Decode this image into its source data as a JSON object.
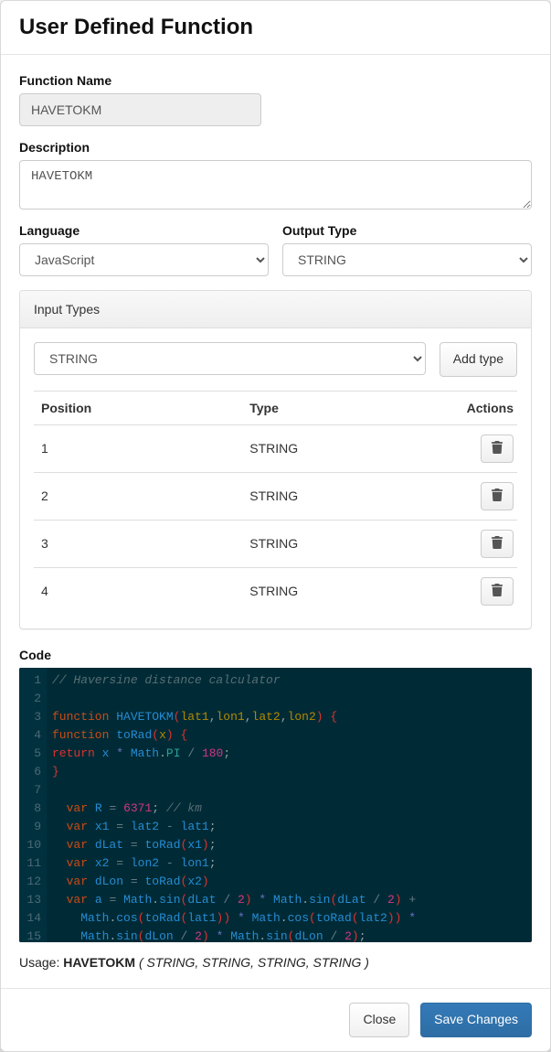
{
  "header": {
    "title": "User Defined Function"
  },
  "form": {
    "functionName": {
      "label": "Function Name",
      "value": "HAVETOKM"
    },
    "description": {
      "label": "Description",
      "value": "HAVETOKM"
    },
    "language": {
      "label": "Language",
      "value": "JavaScript"
    },
    "outputType": {
      "label": "Output Type",
      "value": "STRING"
    }
  },
  "inputTypes": {
    "heading": "Input Types",
    "newTypeSelected": "STRING",
    "addButton": "Add type",
    "columns": {
      "position": "Position",
      "type": "Type",
      "actions": "Actions"
    },
    "rows": [
      {
        "position": "1",
        "type": "STRING"
      },
      {
        "position": "2",
        "type": "STRING"
      },
      {
        "position": "3",
        "type": "STRING"
      },
      {
        "position": "4",
        "type": "STRING"
      }
    ]
  },
  "code": {
    "label": "Code",
    "lines": [
      {
        "n": "1",
        "tokens": [
          {
            "c": "tok-comment",
            "t": "// Haversine distance calculator"
          }
        ]
      },
      {
        "n": "2",
        "tokens": []
      },
      {
        "n": "3",
        "tokens": [
          {
            "c": "tok-keyword",
            "t": "function"
          },
          {
            "c": "tok-plain",
            "t": " "
          },
          {
            "c": "tok-funcname",
            "t": "HAVETOKM"
          },
          {
            "c": "tok-brace",
            "t": "("
          },
          {
            "c": "tok-param",
            "t": "lat1"
          },
          {
            "c": "tok-plain",
            "t": ","
          },
          {
            "c": "tok-param",
            "t": "lon1"
          },
          {
            "c": "tok-plain",
            "t": ","
          },
          {
            "c": "tok-param",
            "t": "lat2"
          },
          {
            "c": "tok-plain",
            "t": ","
          },
          {
            "c": "tok-param",
            "t": "lon2"
          },
          {
            "c": "tok-brace",
            "t": ")"
          },
          {
            "c": "tok-plain",
            "t": " "
          },
          {
            "c": "tok-brace",
            "t": "{"
          }
        ]
      },
      {
        "n": "4",
        "tokens": [
          {
            "c": "tok-keyword",
            "t": "function"
          },
          {
            "c": "tok-plain",
            "t": " "
          },
          {
            "c": "tok-funcname",
            "t": "toRad"
          },
          {
            "c": "tok-brace",
            "t": "("
          },
          {
            "c": "tok-param",
            "t": "x"
          },
          {
            "c": "tok-brace",
            "t": ")"
          },
          {
            "c": "tok-plain",
            "t": " "
          },
          {
            "c": "tok-brace",
            "t": "{"
          }
        ]
      },
      {
        "n": "5",
        "tokens": [
          {
            "c": "tok-ret",
            "t": "return"
          },
          {
            "c": "tok-plain",
            "t": " "
          },
          {
            "c": "tok-ident",
            "t": "x"
          },
          {
            "c": "tok-plain",
            "t": " "
          },
          {
            "c": "tok-star",
            "t": "*"
          },
          {
            "c": "tok-plain",
            "t": " "
          },
          {
            "c": "tok-ident",
            "t": "Math"
          },
          {
            "c": "tok-plain",
            "t": "."
          },
          {
            "c": "tok-member",
            "t": "PI"
          },
          {
            "c": "tok-plain",
            "t": " "
          },
          {
            "c": "tok-op",
            "t": "/"
          },
          {
            "c": "tok-plain",
            "t": " "
          },
          {
            "c": "tok-num",
            "t": "180"
          },
          {
            "c": "tok-plain",
            "t": ";"
          }
        ]
      },
      {
        "n": "6",
        "tokens": [
          {
            "c": "tok-brace",
            "t": "}"
          }
        ]
      },
      {
        "n": "7",
        "tokens": []
      },
      {
        "n": "8",
        "tokens": [
          {
            "c": "tok-plain",
            "t": "  "
          },
          {
            "c": "tok-keyword",
            "t": "var"
          },
          {
            "c": "tok-plain",
            "t": " "
          },
          {
            "c": "tok-ident",
            "t": "R"
          },
          {
            "c": "tok-plain",
            "t": " "
          },
          {
            "c": "tok-op",
            "t": "="
          },
          {
            "c": "tok-plain",
            "t": " "
          },
          {
            "c": "tok-num",
            "t": "6371"
          },
          {
            "c": "tok-plain",
            "t": "; "
          },
          {
            "c": "tok-comment",
            "t": "// km"
          }
        ]
      },
      {
        "n": "9",
        "tokens": [
          {
            "c": "tok-plain",
            "t": "  "
          },
          {
            "c": "tok-keyword",
            "t": "var"
          },
          {
            "c": "tok-plain",
            "t": " "
          },
          {
            "c": "tok-ident",
            "t": "x1"
          },
          {
            "c": "tok-plain",
            "t": " "
          },
          {
            "c": "tok-op",
            "t": "="
          },
          {
            "c": "tok-plain",
            "t": " "
          },
          {
            "c": "tok-ident",
            "t": "lat2"
          },
          {
            "c": "tok-plain",
            "t": " "
          },
          {
            "c": "tok-op",
            "t": "-"
          },
          {
            "c": "tok-plain",
            "t": " "
          },
          {
            "c": "tok-ident",
            "t": "lat1"
          },
          {
            "c": "tok-plain",
            "t": ";"
          }
        ]
      },
      {
        "n": "10",
        "tokens": [
          {
            "c": "tok-plain",
            "t": "  "
          },
          {
            "c": "tok-keyword",
            "t": "var"
          },
          {
            "c": "tok-plain",
            "t": " "
          },
          {
            "c": "tok-ident",
            "t": "dLat"
          },
          {
            "c": "tok-plain",
            "t": " "
          },
          {
            "c": "tok-op",
            "t": "="
          },
          {
            "c": "tok-plain",
            "t": " "
          },
          {
            "c": "tok-funcname",
            "t": "toRad"
          },
          {
            "c": "tok-brace",
            "t": "("
          },
          {
            "c": "tok-ident",
            "t": "x1"
          },
          {
            "c": "tok-brace",
            "t": ")"
          },
          {
            "c": "tok-plain",
            "t": ";"
          }
        ]
      },
      {
        "n": "11",
        "tokens": [
          {
            "c": "tok-plain",
            "t": "  "
          },
          {
            "c": "tok-keyword",
            "t": "var"
          },
          {
            "c": "tok-plain",
            "t": " "
          },
          {
            "c": "tok-ident",
            "t": "x2"
          },
          {
            "c": "tok-plain",
            "t": " "
          },
          {
            "c": "tok-op",
            "t": "="
          },
          {
            "c": "tok-plain",
            "t": " "
          },
          {
            "c": "tok-ident",
            "t": "lon2"
          },
          {
            "c": "tok-plain",
            "t": " "
          },
          {
            "c": "tok-op",
            "t": "-"
          },
          {
            "c": "tok-plain",
            "t": " "
          },
          {
            "c": "tok-ident",
            "t": "lon1"
          },
          {
            "c": "tok-plain",
            "t": ";"
          }
        ]
      },
      {
        "n": "12",
        "tokens": [
          {
            "c": "tok-plain",
            "t": "  "
          },
          {
            "c": "tok-keyword",
            "t": "var"
          },
          {
            "c": "tok-plain",
            "t": " "
          },
          {
            "c": "tok-ident",
            "t": "dLon"
          },
          {
            "c": "tok-plain",
            "t": " "
          },
          {
            "c": "tok-op",
            "t": "="
          },
          {
            "c": "tok-plain",
            "t": " "
          },
          {
            "c": "tok-funcname",
            "t": "toRad"
          },
          {
            "c": "tok-brace",
            "t": "("
          },
          {
            "c": "tok-ident",
            "t": "x2"
          },
          {
            "c": "tok-brace",
            "t": ")"
          }
        ]
      },
      {
        "n": "13",
        "tokens": [
          {
            "c": "tok-plain",
            "t": "  "
          },
          {
            "c": "tok-keyword",
            "t": "var"
          },
          {
            "c": "tok-plain",
            "t": " "
          },
          {
            "c": "tok-ident",
            "t": "a"
          },
          {
            "c": "tok-plain",
            "t": " "
          },
          {
            "c": "tok-op",
            "t": "="
          },
          {
            "c": "tok-plain",
            "t": " "
          },
          {
            "c": "tok-ident",
            "t": "Math"
          },
          {
            "c": "tok-plain",
            "t": "."
          },
          {
            "c": "tok-funcname",
            "t": "sin"
          },
          {
            "c": "tok-brace",
            "t": "("
          },
          {
            "c": "tok-ident",
            "t": "dLat"
          },
          {
            "c": "tok-plain",
            "t": " "
          },
          {
            "c": "tok-op",
            "t": "/"
          },
          {
            "c": "tok-plain",
            "t": " "
          },
          {
            "c": "tok-num",
            "t": "2"
          },
          {
            "c": "tok-brace",
            "t": ")"
          },
          {
            "c": "tok-plain",
            "t": " "
          },
          {
            "c": "tok-star",
            "t": "*"
          },
          {
            "c": "tok-plain",
            "t": " "
          },
          {
            "c": "tok-ident",
            "t": "Math"
          },
          {
            "c": "tok-plain",
            "t": "."
          },
          {
            "c": "tok-funcname",
            "t": "sin"
          },
          {
            "c": "tok-brace",
            "t": "("
          },
          {
            "c": "tok-ident",
            "t": "dLat"
          },
          {
            "c": "tok-plain",
            "t": " "
          },
          {
            "c": "tok-op",
            "t": "/"
          },
          {
            "c": "tok-plain",
            "t": " "
          },
          {
            "c": "tok-num",
            "t": "2"
          },
          {
            "c": "tok-brace",
            "t": ")"
          },
          {
            "c": "tok-plain",
            "t": " "
          },
          {
            "c": "tok-op",
            "t": "+"
          }
        ]
      },
      {
        "n": "14",
        "tokens": [
          {
            "c": "tok-plain",
            "t": "    "
          },
          {
            "c": "tok-ident",
            "t": "Math"
          },
          {
            "c": "tok-plain",
            "t": "."
          },
          {
            "c": "tok-funcname",
            "t": "cos"
          },
          {
            "c": "tok-brace",
            "t": "("
          },
          {
            "c": "tok-funcname",
            "t": "toRad"
          },
          {
            "c": "tok-brace",
            "t": "("
          },
          {
            "c": "tok-ident",
            "t": "lat1"
          },
          {
            "c": "tok-brace",
            "t": "))"
          },
          {
            "c": "tok-plain",
            "t": " "
          },
          {
            "c": "tok-star",
            "t": "*"
          },
          {
            "c": "tok-plain",
            "t": " "
          },
          {
            "c": "tok-ident",
            "t": "Math"
          },
          {
            "c": "tok-plain",
            "t": "."
          },
          {
            "c": "tok-funcname",
            "t": "cos"
          },
          {
            "c": "tok-brace",
            "t": "("
          },
          {
            "c": "tok-funcname",
            "t": "toRad"
          },
          {
            "c": "tok-brace",
            "t": "("
          },
          {
            "c": "tok-ident",
            "t": "lat2"
          },
          {
            "c": "tok-brace",
            "t": "))"
          },
          {
            "c": "tok-plain",
            "t": " "
          },
          {
            "c": "tok-star",
            "t": "*"
          }
        ]
      },
      {
        "n": "15",
        "tokens": [
          {
            "c": "tok-plain",
            "t": "    "
          },
          {
            "c": "tok-ident",
            "t": "Math"
          },
          {
            "c": "tok-plain",
            "t": "."
          },
          {
            "c": "tok-funcname",
            "t": "sin"
          },
          {
            "c": "tok-brace",
            "t": "("
          },
          {
            "c": "tok-ident",
            "t": "dLon"
          },
          {
            "c": "tok-plain",
            "t": " "
          },
          {
            "c": "tok-op",
            "t": "/"
          },
          {
            "c": "tok-plain",
            "t": " "
          },
          {
            "c": "tok-num",
            "t": "2"
          },
          {
            "c": "tok-brace",
            "t": ")"
          },
          {
            "c": "tok-plain",
            "t": " "
          },
          {
            "c": "tok-star",
            "t": "*"
          },
          {
            "c": "tok-plain",
            "t": " "
          },
          {
            "c": "tok-ident",
            "t": "Math"
          },
          {
            "c": "tok-plain",
            "t": "."
          },
          {
            "c": "tok-funcname",
            "t": "sin"
          },
          {
            "c": "tok-brace",
            "t": "("
          },
          {
            "c": "tok-ident",
            "t": "dLon"
          },
          {
            "c": "tok-plain",
            "t": " "
          },
          {
            "c": "tok-op",
            "t": "/"
          },
          {
            "c": "tok-plain",
            "t": " "
          },
          {
            "c": "tok-num",
            "t": "2"
          },
          {
            "c": "tok-brace",
            "t": ")"
          },
          {
            "c": "tok-plain",
            "t": ";"
          }
        ]
      }
    ]
  },
  "usage": {
    "prefix": "Usage: ",
    "fn": "HAVETOKM",
    "args": "( STRING, STRING, STRING, STRING )"
  },
  "footer": {
    "close": "Close",
    "save": "Save Changes"
  }
}
